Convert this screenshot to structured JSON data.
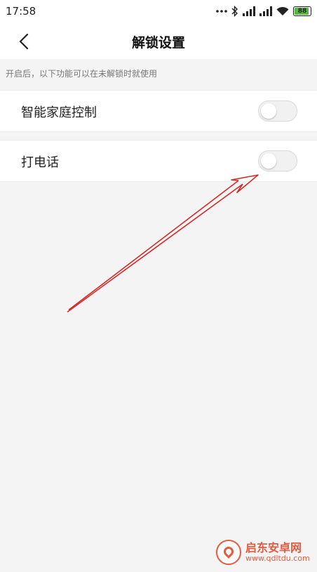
{
  "status_bar": {
    "time": "17:58",
    "battery_level": "88",
    "icons": [
      "more-dots-icon",
      "bluetooth-icon",
      "signal-icon",
      "signal-icon",
      "wifi-icon",
      "battery-icon"
    ]
  },
  "header": {
    "title": "解锁设置",
    "back_icon": "chevron-left-icon"
  },
  "hint": "开启后，以下功能可以在未解锁时就使用",
  "settings": [
    {
      "label": "智能家庭控制",
      "enabled": false
    },
    {
      "label": "打电话",
      "enabled": false
    }
  ],
  "watermark": {
    "name": "启东安卓网",
    "url": "www.qdltdu.com"
  },
  "colors": {
    "annotation_arrow": "#d42a2a",
    "battery_fill": "#55b940",
    "watermark": "#e54a2d"
  }
}
